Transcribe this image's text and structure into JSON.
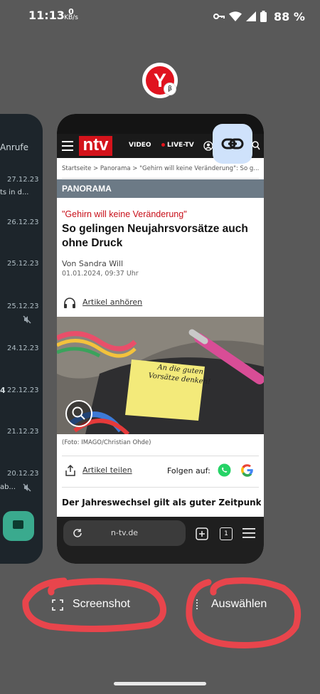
{
  "status_bar": {
    "time": "11:13",
    "net_value": "0",
    "net_unit": "KB/s",
    "battery_pct": "88 %"
  },
  "left_app": {
    "tab_label": "Anrufe",
    "dates": [
      "27.12.23",
      "26.12.23",
      "25.12.23",
      "25.12.23",
      "24.12.23",
      "22.12.23",
      "21.12.23",
      "20.12.23"
    ],
    "snippet_1": "ts in d...",
    "snippet_2": "4",
    "snippet_3": "ab..."
  },
  "browser": {
    "nav": {
      "video": "VIDEO",
      "live": "LIVE-TV",
      "logo_text": "ntv"
    },
    "breadcrumb": "Startseite > Panorama > \"Gehirn will keine Veränderung\": So g...",
    "section": "PANORAMA",
    "kicker": "\"Gehirn will keine Veränderung\"",
    "headline": "So gelingen Neujahrsvorsätze auch ohne Druck",
    "author": "Von Sandra Will",
    "datetime": "01.01.2024, 09:37 Uhr",
    "listen_label": "Artikel anhören",
    "photo_note": "An die guten Vorsätze denken!",
    "photo_caption": "(Foto: IMAGO/Christian Ohde)",
    "share_label": "Artikel teilen",
    "follow_label": "Folgen auf:",
    "teaser": "Der Jahreswechsel gilt als guter Zeitpunkt,",
    "url": "n-tv.de",
    "tab_count": "1"
  },
  "actions": {
    "screenshot": "Screenshot",
    "select": "Auswählen"
  },
  "colors": {
    "background": "#595959",
    "ntv_red": "#d4131b",
    "annotation_red": "#e8454c",
    "link_button": "#cfe2fb"
  }
}
